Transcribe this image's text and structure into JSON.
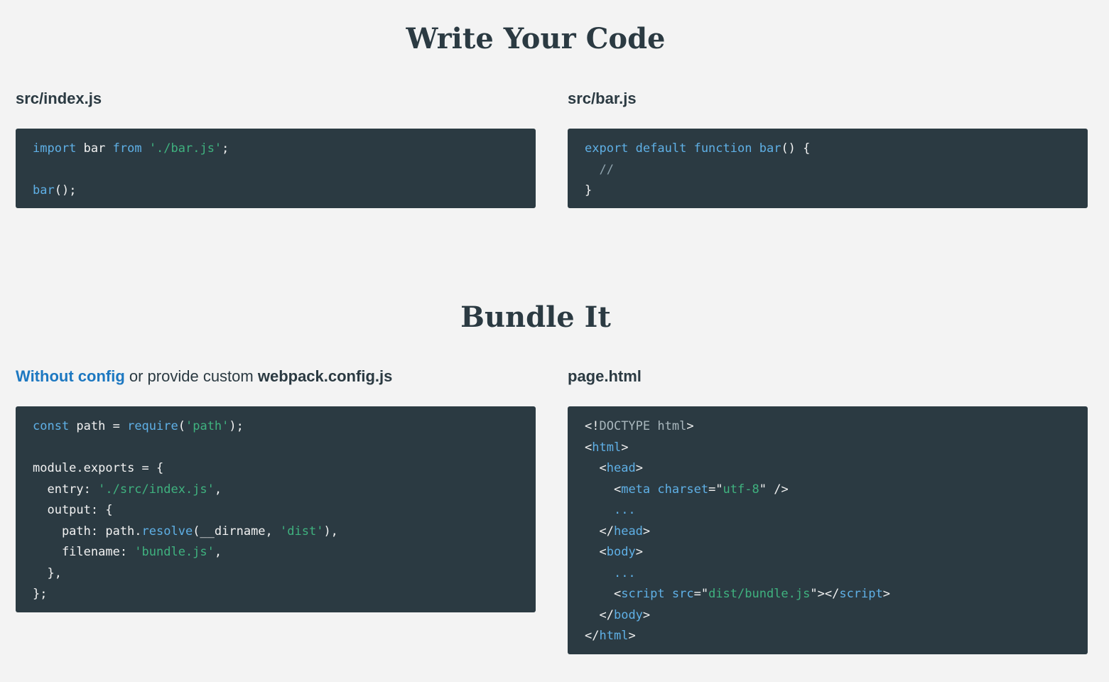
{
  "sections": [
    {
      "title": "Write Your Code"
    },
    {
      "title": "Bundle It"
    }
  ],
  "write": {
    "left_heading": "src/index.js",
    "right_heading": "src/bar.js",
    "left_code": [
      [
        [
          "keyword",
          "import"
        ],
        [
          "plain",
          " bar "
        ],
        [
          "keyword",
          "from"
        ],
        [
          "plain",
          " "
        ],
        [
          "string",
          "'./bar.js'"
        ],
        [
          "plain",
          ";"
        ]
      ],
      [],
      [
        [
          "keyword",
          "bar"
        ],
        [
          "plain",
          "();"
        ]
      ]
    ],
    "right_code": [
      [
        [
          "keyword",
          "export"
        ],
        [
          "plain",
          " "
        ],
        [
          "keyword",
          "default"
        ],
        [
          "plain",
          " "
        ],
        [
          "keyword",
          "function"
        ],
        [
          "plain",
          " "
        ],
        [
          "keyword",
          "bar"
        ],
        [
          "plain",
          "() {"
        ]
      ],
      [
        [
          "plain",
          "  "
        ],
        [
          "comment",
          "//"
        ]
      ],
      [
        [
          "plain",
          "}"
        ]
      ]
    ]
  },
  "bundle": {
    "left_heading": {
      "link_text": "Without config",
      "middle_text": " or provide custom ",
      "bold_text": "webpack.config.js"
    },
    "right_heading": "page.html",
    "left_code": [
      [
        [
          "keyword",
          "const"
        ],
        [
          "plain",
          " path = "
        ],
        [
          "keyword",
          "require"
        ],
        [
          "plain",
          "("
        ],
        [
          "string",
          "'path'"
        ],
        [
          "plain",
          ");"
        ]
      ],
      [],
      [
        [
          "plain",
          "module."
        ],
        [
          "plain",
          "exports = {"
        ]
      ],
      [
        [
          "plain",
          "  entry: "
        ],
        [
          "string",
          "'./src/index.js'"
        ],
        [
          "plain",
          ","
        ]
      ],
      [
        [
          "plain",
          "  output: {"
        ]
      ],
      [
        [
          "plain",
          "    path: path."
        ],
        [
          "keyword",
          "resolve"
        ],
        [
          "plain",
          "(__dirname, "
        ],
        [
          "string",
          "'dist'"
        ],
        [
          "plain",
          "),"
        ]
      ],
      [
        [
          "plain",
          "    filename: "
        ],
        [
          "string",
          "'bundle.js'"
        ],
        [
          "plain",
          ","
        ]
      ],
      [
        [
          "plain",
          "  },"
        ]
      ],
      [
        [
          "plain",
          "};"
        ]
      ]
    ],
    "right_code": [
      [
        [
          "punct",
          "<!"
        ],
        [
          "doctype",
          "DOCTYPE html"
        ],
        [
          "punct",
          ">"
        ]
      ],
      [
        [
          "punct",
          "<"
        ],
        [
          "tag",
          "html"
        ],
        [
          "punct",
          ">"
        ]
      ],
      [
        [
          "plain",
          "  "
        ],
        [
          "punct",
          "<"
        ],
        [
          "tag",
          "head"
        ],
        [
          "punct",
          ">"
        ]
      ],
      [
        [
          "plain",
          "    "
        ],
        [
          "punct",
          "<"
        ],
        [
          "tag",
          "meta"
        ],
        [
          "plain",
          " "
        ],
        [
          "attr",
          "charset"
        ],
        [
          "punct",
          "=\""
        ],
        [
          "string",
          "utf-8"
        ],
        [
          "punct",
          "\" />"
        ]
      ],
      [
        [
          "plain",
          "    "
        ],
        [
          "keyword",
          "..."
        ]
      ],
      [
        [
          "plain",
          "  "
        ],
        [
          "punct",
          "</"
        ],
        [
          "tag",
          "head"
        ],
        [
          "punct",
          ">"
        ]
      ],
      [
        [
          "plain",
          "  "
        ],
        [
          "punct",
          "<"
        ],
        [
          "tag",
          "body"
        ],
        [
          "punct",
          ">"
        ]
      ],
      [
        [
          "plain",
          "    "
        ],
        [
          "keyword",
          "..."
        ]
      ],
      [
        [
          "plain",
          "    "
        ],
        [
          "punct",
          "<"
        ],
        [
          "tag",
          "script"
        ],
        [
          "plain",
          " "
        ],
        [
          "attr",
          "src"
        ],
        [
          "punct",
          "=\""
        ],
        [
          "string",
          "dist/bundle.js"
        ],
        [
          "punct",
          "\"></"
        ],
        [
          "tag",
          "script"
        ],
        [
          "punct",
          ">"
        ]
      ],
      [
        [
          "plain",
          "  "
        ],
        [
          "punct",
          "</"
        ],
        [
          "tag",
          "body"
        ],
        [
          "punct",
          ">"
        ]
      ],
      [
        [
          "punct",
          "</"
        ],
        [
          "tag",
          "html"
        ],
        [
          "punct",
          ">"
        ]
      ]
    ]
  }
}
